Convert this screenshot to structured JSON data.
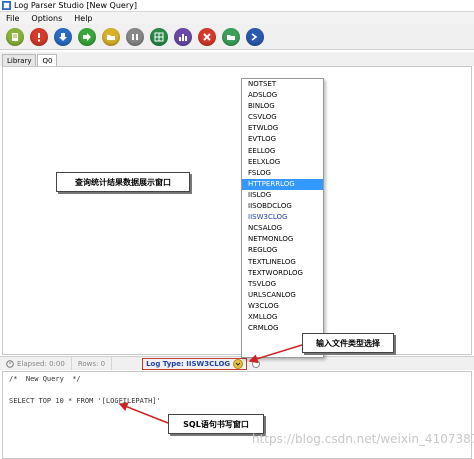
{
  "window": {
    "title": "Log Parser Studio  [New Query]"
  },
  "menu": [
    "File",
    "Options",
    "Help"
  ],
  "toolbar": {
    "buttons": [
      {
        "name": "new-query-button",
        "color": "#8ab23a",
        "icon": "document"
      },
      {
        "name": "stop-button",
        "color": "#d43a2a",
        "icon": "!"
      },
      {
        "name": "download-button",
        "color": "#2a6bc4",
        "icon": "down-arrow"
      },
      {
        "name": "run-button",
        "color": "#3aa53a",
        "icon": "right-arrow"
      },
      {
        "name": "open-folder-button",
        "color": "#d8b02a",
        "icon": "folder"
      },
      {
        "name": "pause-button",
        "color": "#888888",
        "icon": "pause"
      },
      {
        "name": "export-button",
        "color": "#2a8a4a",
        "icon": "grid"
      },
      {
        "name": "chart-button",
        "color": "#6a4aa8",
        "icon": "chart"
      },
      {
        "name": "close-button",
        "color": "#d43a2a",
        "icon": "x"
      },
      {
        "name": "folder-button",
        "color": "#3aa05a",
        "icon": "folder"
      },
      {
        "name": "powershell-button",
        "color": "#2a5ab0",
        "icon": "prompt"
      }
    ]
  },
  "tabs": [
    "Library",
    "Q0"
  ],
  "status": {
    "elapsed": "Elapsed: 0:00",
    "rows": "Rows: 0",
    "log_type": "Log Type: IISW3CLOG"
  },
  "dropdown": {
    "items": [
      "NOTSET",
      "ADSLOG",
      "BINLOG",
      "CSVLOG",
      "ETWLOG",
      "EVTLOG",
      "EELLOG",
      "EELXLOG",
      "FSLOG",
      "HTTPERRLOG",
      "IISLOG",
      "IISOBDCLOG",
      "IISW3CLOG",
      "NCSALOG",
      "NETMONLOG",
      "REGLOG",
      "TEXTLINELOG",
      "TEXTWORDLOG",
      "TSVLOG",
      "URLSCANLOG",
      "W3CLOG",
      "XMLLOG",
      "CRMLOG"
    ],
    "highlighted": "HTTPERRLOG",
    "current": "IISW3CLOG"
  },
  "editor": {
    "lines": [
      "/*  New Query  */",
      "",
      "SELECT TOP 10 * FROM '[LOGFILEPATH]'"
    ]
  },
  "annotations": {
    "results_label": "查询统计结果数据展示窗口",
    "filetype_label": "输入文件类型选择",
    "sql_label": "SQL语句书写窗口"
  },
  "watermark": "https://blog.csdn.net/weixin_41073877"
}
